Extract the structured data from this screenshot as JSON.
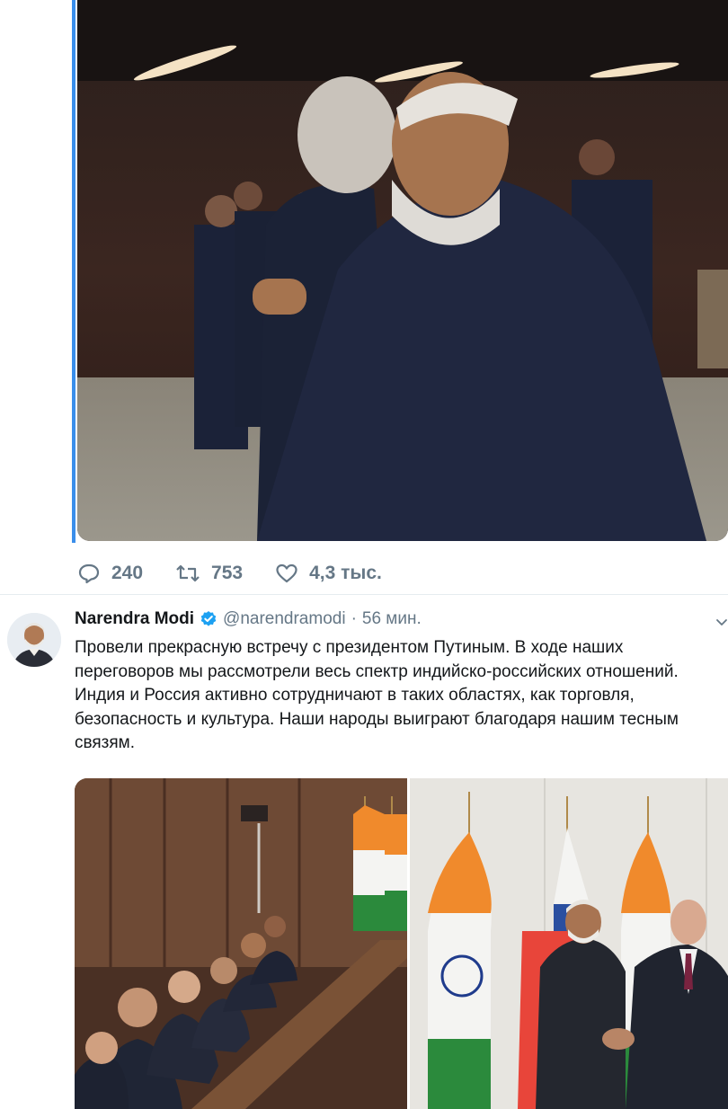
{
  "prev_tweet": {
    "stats": {
      "replies": "240",
      "retweets": "753",
      "likes": "4,3 тыс."
    },
    "icons": {
      "reply": "reply-icon",
      "retweet": "retweet-icon",
      "like": "heart-icon"
    }
  },
  "tweet": {
    "author_name": "Narendra Modi",
    "handle": "@narendramodi",
    "separator": "·",
    "time": "56 мин.",
    "text": "Провели прекрасную встречу с президентом Путиным. В ходе наших переговоров мы рассмотрели весь спектр индийско-российских отношений. Индия и Россия активно сотрудничают в таких областях, как торговля, безопасность и культура. Наши народы выиграют благодаря нашим тесным связям.",
    "icons": {
      "verified": "verified-badge-icon",
      "menu": "chevron-down-icon"
    }
  },
  "colors": {
    "accent": "#1da1f2",
    "thread_line": "#3a8eea",
    "muted_text": "#657786",
    "divider": "#e6ecf0"
  }
}
